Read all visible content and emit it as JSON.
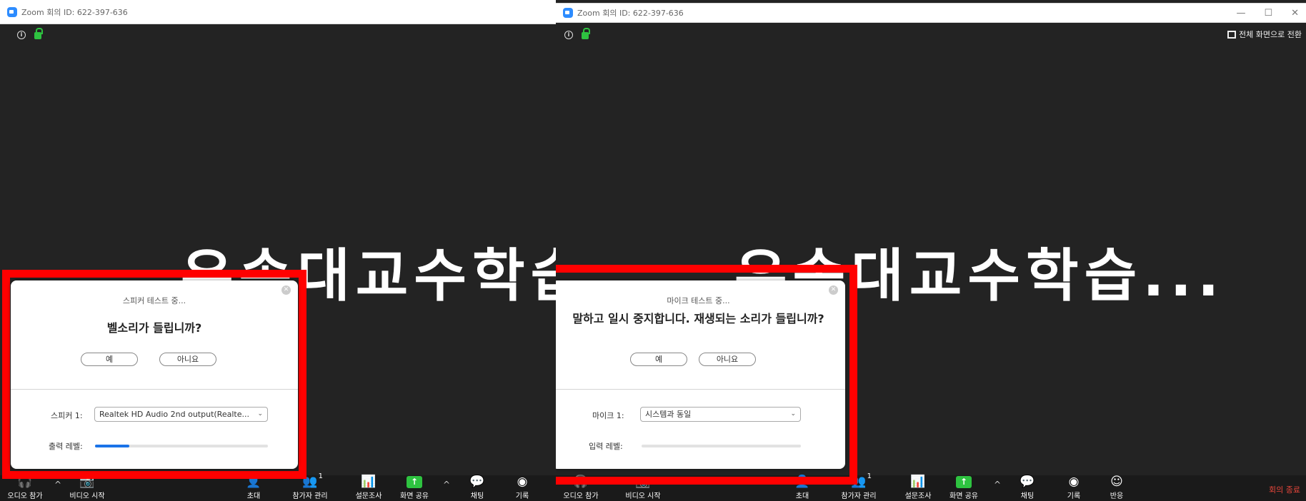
{
  "left_window": {
    "title": "Zoom 회의 ID: 622-397-636",
    "meeting_name": "우송대교수학습",
    "dialog": {
      "subtitle": "스피커 테스트 중...",
      "question": "벨소리가 들립니까?",
      "yes": "예",
      "no": "아니요",
      "device_label": "스피커 1:",
      "device_value": "Realtek HD Audio 2nd output(Realte...",
      "level_label": "출력 레벨:",
      "level_fraction": 0.2
    },
    "toolbar": {
      "audio": "오디오 참가",
      "video": "비디오 시작",
      "invite": "초대",
      "participants": "참가자 관리",
      "participants_count": "1",
      "polls": "설문조사",
      "share": "화면 공유",
      "chat": "채팅",
      "record": "기록"
    }
  },
  "right_window": {
    "title": "Zoom 회의 ID: 622-397-636",
    "fullscreen": "전체 화면으로 전환",
    "meeting_name": "우송대교수학습...",
    "dialog": {
      "subtitle": "마이크 테스트 중...",
      "question": "말하고 일시 중지합니다. 재생되는 소리가 들립니까?",
      "yes": "예",
      "no": "아니요",
      "device_label": "마이크 1:",
      "device_value": "시스템과 동일",
      "level_label": "입력 레벨:",
      "level_fraction": 0.0
    },
    "toolbar": {
      "audio": "오디오 참가",
      "video": "비디오 시작",
      "invite": "초대",
      "participants": "참가자 관리",
      "participants_count": "1",
      "polls": "설문조사",
      "share": "화면 공유",
      "chat": "채팅",
      "record": "기록",
      "reactions": "반응",
      "end": "회의 종료"
    }
  },
  "colors": {
    "highlight": "#ff0000",
    "accent": "#2d8cff",
    "green": "#2ec340",
    "end": "#e8463b"
  }
}
